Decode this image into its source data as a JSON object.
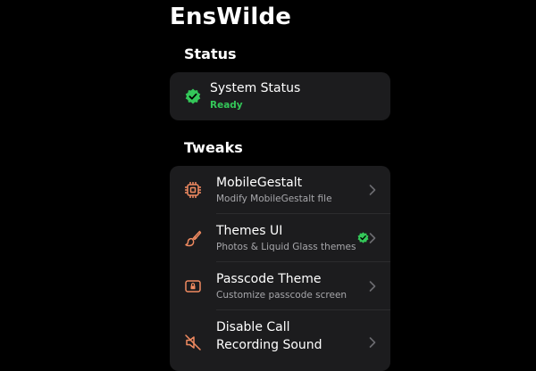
{
  "app": {
    "title": "EnsWilde"
  },
  "colors": {
    "accent": "#f08a60",
    "success": "#34c759",
    "background": "#000000",
    "card": "#1c1c1e"
  },
  "status_section": {
    "header": "Status",
    "item": {
      "icon": "check-seal-icon",
      "title": "System Status",
      "subtitle": "Ready"
    }
  },
  "tweaks_section": {
    "header": "Tweaks",
    "items": [
      {
        "icon": "chip-icon",
        "title": "MobileGestalt",
        "subtitle": "Modify MobileGestalt file"
      },
      {
        "icon": "paintbrush-icon",
        "title": "Themes UI",
        "subtitle": "Photos & Liquid Glass themes",
        "badge": "check-seal-icon"
      },
      {
        "icon": "lock-icon",
        "title": "Passcode Theme",
        "subtitle": "Customize passcode screen"
      },
      {
        "icon": "speaker-slash-icon",
        "title_line1": "Disable Call",
        "title_line2": "Recording Sound"
      }
    ]
  }
}
